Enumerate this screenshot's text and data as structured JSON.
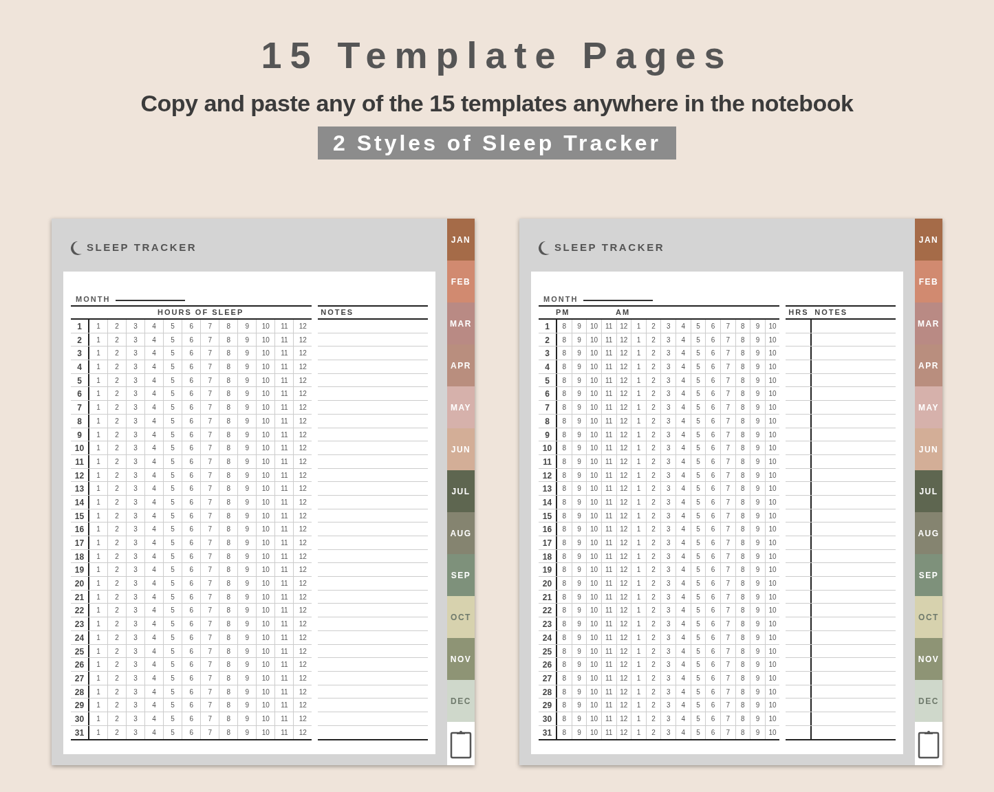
{
  "title": "15 Template Pages",
  "subtitle": "Copy and paste any of the 15 templates anywhere in the notebook",
  "badge": "2 Styles of Sleep Tracker",
  "pages": [
    {
      "kind": "single",
      "title": "SLEEP TRACKER",
      "month_label": "MONTH",
      "grid_headers": [
        "HOURS OF SLEEP"
      ],
      "notes_headers": [
        "NOTES"
      ],
      "rows": [
        {
          "day": "1",
          "cells": [
            "1",
            "2",
            "3",
            "4",
            "5",
            "6",
            "7",
            "8",
            "9",
            "10",
            "11",
            "12"
          ]
        },
        {
          "day": "2",
          "cells": [
            "1",
            "2",
            "3",
            "4",
            "5",
            "6",
            "7",
            "8",
            "9",
            "10",
            "11",
            "12"
          ]
        },
        {
          "day": "3",
          "cells": [
            "1",
            "2",
            "3",
            "4",
            "5",
            "6",
            "7",
            "8",
            "9",
            "10",
            "11",
            "12"
          ]
        },
        {
          "day": "4",
          "cells": [
            "1",
            "2",
            "3",
            "4",
            "5",
            "6",
            "7",
            "8",
            "9",
            "10",
            "11",
            "12"
          ]
        },
        {
          "day": "5",
          "cells": [
            "1",
            "2",
            "3",
            "4",
            "5",
            "6",
            "7",
            "8",
            "9",
            "10",
            "11",
            "12"
          ]
        },
        {
          "day": "6",
          "cells": [
            "1",
            "2",
            "3",
            "4",
            "5",
            "6",
            "7",
            "8",
            "9",
            "10",
            "11",
            "12"
          ]
        },
        {
          "day": "7",
          "cells": [
            "1",
            "2",
            "3",
            "4",
            "5",
            "6",
            "7",
            "8",
            "9",
            "10",
            "11",
            "12"
          ]
        },
        {
          "day": "8",
          "cells": [
            "1",
            "2",
            "3",
            "4",
            "5",
            "6",
            "7",
            "8",
            "9",
            "10",
            "11",
            "12"
          ]
        },
        {
          "day": "9",
          "cells": [
            "1",
            "2",
            "3",
            "4",
            "5",
            "6",
            "7",
            "8",
            "9",
            "10",
            "11",
            "12"
          ]
        },
        {
          "day": "10",
          "cells": [
            "1",
            "2",
            "3",
            "4",
            "5",
            "6",
            "7",
            "8",
            "9",
            "10",
            "11",
            "12"
          ]
        },
        {
          "day": "11",
          "cells": [
            "1",
            "2",
            "3",
            "4",
            "5",
            "6",
            "7",
            "8",
            "9",
            "10",
            "11",
            "12"
          ]
        },
        {
          "day": "12",
          "cells": [
            "1",
            "2",
            "3",
            "4",
            "5",
            "6",
            "7",
            "8",
            "9",
            "10",
            "11",
            "12"
          ]
        },
        {
          "day": "13",
          "cells": [
            "1",
            "2",
            "3",
            "4",
            "5",
            "6",
            "7",
            "8",
            "9",
            "10",
            "11",
            "12"
          ]
        },
        {
          "day": "14",
          "cells": [
            "1",
            "2",
            "3",
            "4",
            "5",
            "6",
            "7",
            "8",
            "9",
            "10",
            "11",
            "12"
          ]
        },
        {
          "day": "15",
          "cells": [
            "1",
            "2",
            "3",
            "4",
            "5",
            "6",
            "7",
            "8",
            "9",
            "10",
            "11",
            "12"
          ]
        },
        {
          "day": "16",
          "cells": [
            "1",
            "2",
            "3",
            "4",
            "5",
            "6",
            "7",
            "8",
            "9",
            "10",
            "11",
            "12"
          ]
        },
        {
          "day": "17",
          "cells": [
            "1",
            "2",
            "3",
            "4",
            "5",
            "6",
            "7",
            "8",
            "9",
            "10",
            "11",
            "12"
          ]
        },
        {
          "day": "18",
          "cells": [
            "1",
            "2",
            "3",
            "4",
            "5",
            "6",
            "7",
            "8",
            "9",
            "10",
            "11",
            "12"
          ]
        },
        {
          "day": "19",
          "cells": [
            "1",
            "2",
            "3",
            "4",
            "5",
            "6",
            "7",
            "8",
            "9",
            "10",
            "11",
            "12"
          ]
        },
        {
          "day": "20",
          "cells": [
            "1",
            "2",
            "3",
            "4",
            "5",
            "6",
            "7",
            "8",
            "9",
            "10",
            "11",
            "12"
          ]
        },
        {
          "day": "21",
          "cells": [
            "1",
            "2",
            "3",
            "4",
            "5",
            "6",
            "7",
            "8",
            "9",
            "10",
            "11",
            "12"
          ]
        },
        {
          "day": "22",
          "cells": [
            "1",
            "2",
            "3",
            "4",
            "5",
            "6",
            "7",
            "8",
            "9",
            "10",
            "11",
            "12"
          ]
        },
        {
          "day": "23",
          "cells": [
            "1",
            "2",
            "3",
            "4",
            "5",
            "6",
            "7",
            "8",
            "9",
            "10",
            "11",
            "12"
          ]
        },
        {
          "day": "24",
          "cells": [
            "1",
            "2",
            "3",
            "4",
            "5",
            "6",
            "7",
            "8",
            "9",
            "10",
            "11",
            "12"
          ]
        },
        {
          "day": "25",
          "cells": [
            "1",
            "2",
            "3",
            "4",
            "5",
            "6",
            "7",
            "8",
            "9",
            "10",
            "11",
            "12"
          ]
        },
        {
          "day": "26",
          "cells": [
            "1",
            "2",
            "3",
            "4",
            "5",
            "6",
            "7",
            "8",
            "9",
            "10",
            "11",
            "12"
          ]
        },
        {
          "day": "27",
          "cells": [
            "1",
            "2",
            "3",
            "4",
            "5",
            "6",
            "7",
            "8",
            "9",
            "10",
            "11",
            "12"
          ]
        },
        {
          "day": "28",
          "cells": [
            "1",
            "2",
            "3",
            "4",
            "5",
            "6",
            "7",
            "8",
            "9",
            "10",
            "11",
            "12"
          ]
        },
        {
          "day": "29",
          "cells": [
            "1",
            "2",
            "3",
            "4",
            "5",
            "6",
            "7",
            "8",
            "9",
            "10",
            "11",
            "12"
          ]
        },
        {
          "day": "30",
          "cells": [
            "1",
            "2",
            "3",
            "4",
            "5",
            "6",
            "7",
            "8",
            "9",
            "10",
            "11",
            "12"
          ]
        },
        {
          "day": "31",
          "cells": [
            "1",
            "2",
            "3",
            "4",
            "5",
            "6",
            "7",
            "8",
            "9",
            "10",
            "11",
            "12"
          ]
        }
      ],
      "tabs": [
        {
          "label": "JAN",
          "color": "#a56b48"
        },
        {
          "label": "FEB",
          "color": "#d18a70"
        },
        {
          "label": "MAR",
          "color": "#b98a84"
        },
        {
          "label": "APR",
          "color": "#b98e7e"
        },
        {
          "label": "MAY",
          "color": "#d6b1ab"
        },
        {
          "label": "JUN",
          "color": "#d3ae97"
        },
        {
          "label": "JUL",
          "color": "#5e6650"
        },
        {
          "label": "AUG",
          "color": "#858470"
        },
        {
          "label": "SEP",
          "color": "#7e917b"
        },
        {
          "label": "OCT",
          "color": "#d7d2ae"
        },
        {
          "label": "NOV",
          "color": "#8e9475"
        },
        {
          "label": "DEC",
          "color": "#cfd8cb"
        }
      ]
    },
    {
      "kind": "split",
      "title": "SLEEP TRACKER",
      "month_label": "MONTH",
      "grid_headers": [
        "PM",
        "AM"
      ],
      "notes_headers": [
        "HRS",
        "NOTES"
      ],
      "rows": [
        {
          "day": "1",
          "cells": [
            "8",
            "9",
            "10",
            "11",
            "12",
            "1",
            "2",
            "3",
            "4",
            "5",
            "6",
            "7",
            "8",
            "9",
            "10"
          ]
        },
        {
          "day": "2",
          "cells": [
            "8",
            "9",
            "10",
            "11",
            "12",
            "1",
            "2",
            "3",
            "4",
            "5",
            "6",
            "7",
            "8",
            "9",
            "10"
          ]
        },
        {
          "day": "3",
          "cells": [
            "8",
            "9",
            "10",
            "11",
            "12",
            "1",
            "2",
            "3",
            "4",
            "5",
            "6",
            "7",
            "8",
            "9",
            "10"
          ]
        },
        {
          "day": "4",
          "cells": [
            "8",
            "9",
            "10",
            "11",
            "12",
            "1",
            "2",
            "3",
            "4",
            "5",
            "6",
            "7",
            "8",
            "9",
            "10"
          ]
        },
        {
          "day": "5",
          "cells": [
            "8",
            "9",
            "10",
            "11",
            "12",
            "1",
            "2",
            "3",
            "4",
            "5",
            "6",
            "7",
            "8",
            "9",
            "10"
          ]
        },
        {
          "day": "6",
          "cells": [
            "8",
            "9",
            "10",
            "11",
            "12",
            "1",
            "2",
            "3",
            "4",
            "5",
            "6",
            "7",
            "8",
            "9",
            "10"
          ]
        },
        {
          "day": "7",
          "cells": [
            "8",
            "9",
            "10",
            "11",
            "12",
            "1",
            "2",
            "3",
            "4",
            "5",
            "6",
            "7",
            "8",
            "9",
            "10"
          ]
        },
        {
          "day": "8",
          "cells": [
            "8",
            "9",
            "10",
            "11",
            "12",
            "1",
            "2",
            "3",
            "4",
            "5",
            "6",
            "7",
            "8",
            "9",
            "10"
          ]
        },
        {
          "day": "9",
          "cells": [
            "8",
            "9",
            "10",
            "11",
            "12",
            "1",
            "2",
            "3",
            "4",
            "5",
            "6",
            "7",
            "8",
            "9",
            "10"
          ]
        },
        {
          "day": "10",
          "cells": [
            "8",
            "9",
            "10",
            "11",
            "12",
            "1",
            "2",
            "3",
            "4",
            "5",
            "6",
            "7",
            "8",
            "9",
            "10"
          ]
        },
        {
          "day": "11",
          "cells": [
            "8",
            "9",
            "10",
            "11",
            "12",
            "1",
            "2",
            "3",
            "4",
            "5",
            "6",
            "7",
            "8",
            "9",
            "10"
          ]
        },
        {
          "day": "12",
          "cells": [
            "8",
            "9",
            "10",
            "11",
            "12",
            "1",
            "2",
            "3",
            "4",
            "5",
            "6",
            "7",
            "8",
            "9",
            "10"
          ]
        },
        {
          "day": "13",
          "cells": [
            "8",
            "9",
            "10",
            "11",
            "12",
            "1",
            "2",
            "3",
            "4",
            "5",
            "6",
            "7",
            "8",
            "9",
            "10"
          ]
        },
        {
          "day": "14",
          "cells": [
            "8",
            "9",
            "10",
            "11",
            "12",
            "1",
            "2",
            "3",
            "4",
            "5",
            "6",
            "7",
            "8",
            "9",
            "10"
          ]
        },
        {
          "day": "15",
          "cells": [
            "8",
            "9",
            "10",
            "11",
            "12",
            "1",
            "2",
            "3",
            "4",
            "5",
            "6",
            "7",
            "8",
            "9",
            "10"
          ]
        },
        {
          "day": "16",
          "cells": [
            "8",
            "9",
            "10",
            "11",
            "12",
            "1",
            "2",
            "3",
            "4",
            "5",
            "6",
            "7",
            "8",
            "9",
            "10"
          ]
        },
        {
          "day": "17",
          "cells": [
            "8",
            "9",
            "10",
            "11",
            "12",
            "1",
            "2",
            "3",
            "4",
            "5",
            "6",
            "7",
            "8",
            "9",
            "10"
          ]
        },
        {
          "day": "18",
          "cells": [
            "8",
            "9",
            "10",
            "11",
            "12",
            "1",
            "2",
            "3",
            "4",
            "5",
            "6",
            "7",
            "8",
            "9",
            "10"
          ]
        },
        {
          "day": "19",
          "cells": [
            "8",
            "9",
            "10",
            "11",
            "12",
            "1",
            "2",
            "3",
            "4",
            "5",
            "6",
            "7",
            "8",
            "9",
            "10"
          ]
        },
        {
          "day": "20",
          "cells": [
            "8",
            "9",
            "10",
            "11",
            "12",
            "1",
            "2",
            "3",
            "4",
            "5",
            "6",
            "7",
            "8",
            "9",
            "10"
          ]
        },
        {
          "day": "21",
          "cells": [
            "8",
            "9",
            "10",
            "11",
            "12",
            "1",
            "2",
            "3",
            "4",
            "5",
            "6",
            "7",
            "8",
            "9",
            "10"
          ]
        },
        {
          "day": "22",
          "cells": [
            "8",
            "9",
            "10",
            "11",
            "12",
            "1",
            "2",
            "3",
            "4",
            "5",
            "6",
            "7",
            "8",
            "9",
            "10"
          ]
        },
        {
          "day": "23",
          "cells": [
            "8",
            "9",
            "10",
            "11",
            "12",
            "1",
            "2",
            "3",
            "4",
            "5",
            "6",
            "7",
            "8",
            "9",
            "10"
          ]
        },
        {
          "day": "24",
          "cells": [
            "8",
            "9",
            "10",
            "11",
            "12",
            "1",
            "2",
            "3",
            "4",
            "5",
            "6",
            "7",
            "8",
            "9",
            "10"
          ]
        },
        {
          "day": "25",
          "cells": [
            "8",
            "9",
            "10",
            "11",
            "12",
            "1",
            "2",
            "3",
            "4",
            "5",
            "6",
            "7",
            "8",
            "9",
            "10"
          ]
        },
        {
          "day": "26",
          "cells": [
            "8",
            "9",
            "10",
            "11",
            "12",
            "1",
            "2",
            "3",
            "4",
            "5",
            "6",
            "7",
            "8",
            "9",
            "10"
          ]
        },
        {
          "day": "27",
          "cells": [
            "8",
            "9",
            "10",
            "11",
            "12",
            "1",
            "2",
            "3",
            "4",
            "5",
            "6",
            "7",
            "8",
            "9",
            "10"
          ]
        },
        {
          "day": "28",
          "cells": [
            "8",
            "9",
            "10",
            "11",
            "12",
            "1",
            "2",
            "3",
            "4",
            "5",
            "6",
            "7",
            "8",
            "9",
            "10"
          ]
        },
        {
          "day": "29",
          "cells": [
            "8",
            "9",
            "10",
            "11",
            "12",
            "1",
            "2",
            "3",
            "4",
            "5",
            "6",
            "7",
            "8",
            "9",
            "10"
          ]
        },
        {
          "day": "30",
          "cells": [
            "8",
            "9",
            "10",
            "11",
            "12",
            "1",
            "2",
            "3",
            "4",
            "5",
            "6",
            "7",
            "8",
            "9",
            "10"
          ]
        },
        {
          "day": "31",
          "cells": [
            "8",
            "9",
            "10",
            "11",
            "12",
            "1",
            "2",
            "3",
            "4",
            "5",
            "6",
            "7",
            "8",
            "9",
            "10"
          ]
        }
      ],
      "tabs": [
        {
          "label": "JAN",
          "color": "#a56b48"
        },
        {
          "label": "FEB",
          "color": "#d18a70"
        },
        {
          "label": "MAR",
          "color": "#b98a84"
        },
        {
          "label": "APR",
          "color": "#b98e7e"
        },
        {
          "label": "MAY",
          "color": "#d6b1ab"
        },
        {
          "label": "JUN",
          "color": "#d3ae97"
        },
        {
          "label": "JUL",
          "color": "#5e6650"
        },
        {
          "label": "AUG",
          "color": "#858470"
        },
        {
          "label": "SEP",
          "color": "#7e917b"
        },
        {
          "label": "OCT",
          "color": "#d7d2ae"
        },
        {
          "label": "NOV",
          "color": "#8e9475"
        },
        {
          "label": "DEC",
          "color": "#cfd8cb"
        }
      ]
    }
  ]
}
